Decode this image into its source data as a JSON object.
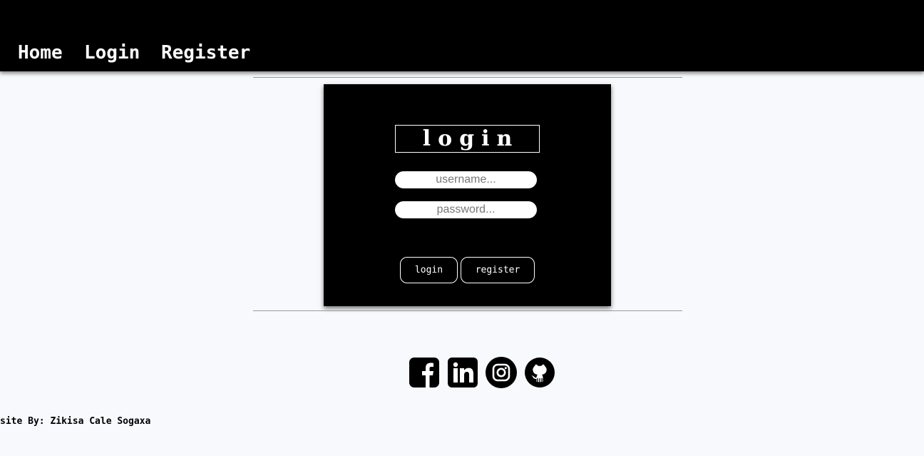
{
  "nav": {
    "home": "Home",
    "login": "Login",
    "register": "Register"
  },
  "login_form": {
    "title": "login",
    "username_placeholder": "username...",
    "password_placeholder": "password...",
    "login_button": "login",
    "register_button": "register"
  },
  "social": {
    "icons": [
      "facebook-icon",
      "linkedin-icon",
      "instagram-icon",
      "github-icon"
    ]
  },
  "footer": {
    "credit": "site By: Zikisa Cale Sogaxa"
  },
  "colors": {
    "navbar": "#000000",
    "page_background": "#f8f9fd",
    "panel": "#000000"
  }
}
